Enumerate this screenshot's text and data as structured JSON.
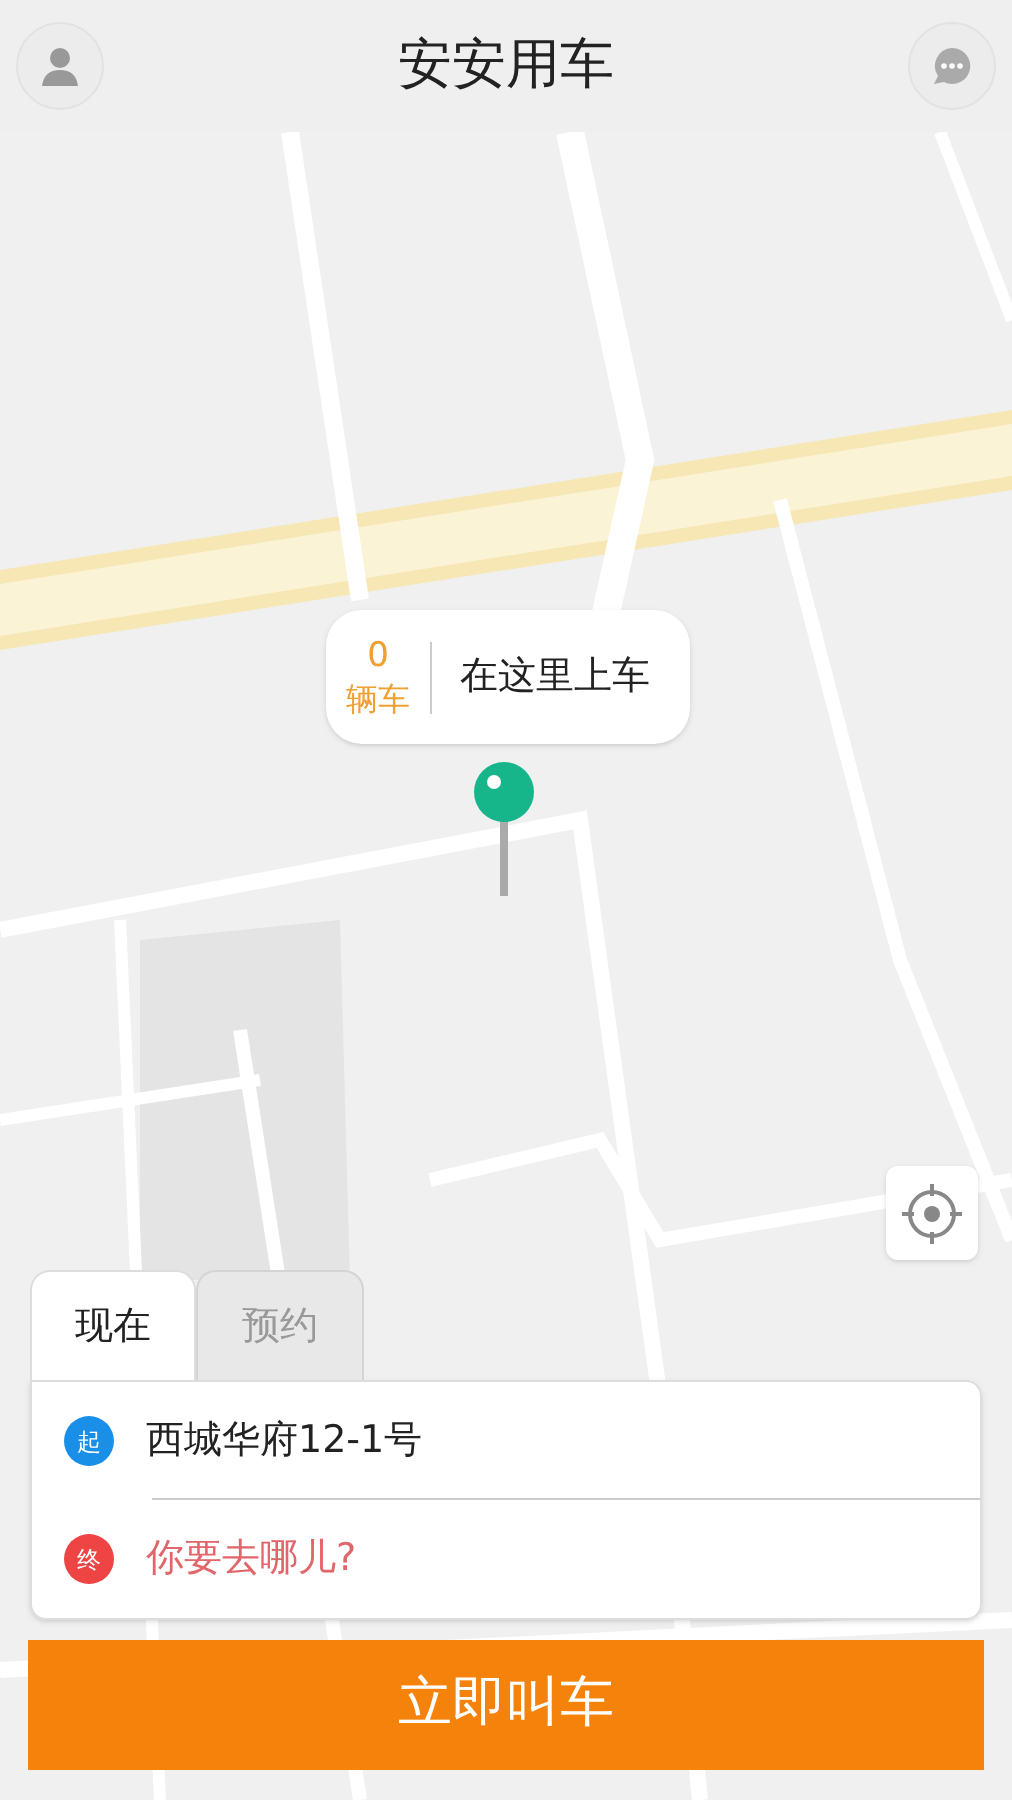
{
  "header": {
    "title": "安安用车"
  },
  "pickup_bubble": {
    "count": "0",
    "unit": "辆车",
    "action": "在这里上车"
  },
  "tabs": [
    {
      "label": "现在",
      "selected": true
    },
    {
      "label": "预约",
      "selected": false
    }
  ],
  "route": [
    {
      "kind": "origin",
      "marker": "起",
      "color": "#1a8fe8",
      "value": "西城华府12-1号"
    },
    {
      "kind": "destination",
      "marker": "终",
      "color": "#ee4444",
      "placeholder": "你要去哪儿?"
    }
  ],
  "call_button": {
    "label": "立即叫车"
  }
}
